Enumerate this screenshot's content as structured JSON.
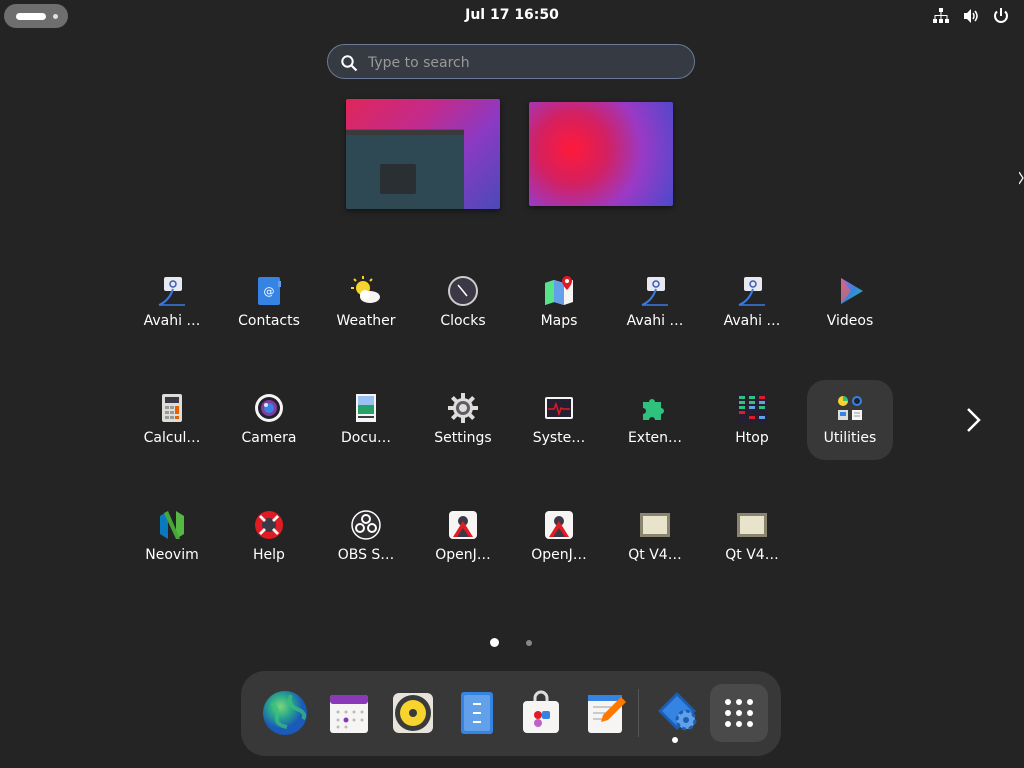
{
  "topbar": {
    "clock": "Jul 17  16:50",
    "tray_icons": [
      "network-icon",
      "volume-icon",
      "power-icon"
    ]
  },
  "search": {
    "placeholder": "Type to search",
    "value": ""
  },
  "app_grid": {
    "rows": [
      [
        {
          "label": "Avahi …",
          "icon": "avahi-icon"
        },
        {
          "label": "Contacts",
          "icon": "contacts-icon"
        },
        {
          "label": "Weather",
          "icon": "weather-icon"
        },
        {
          "label": "Clocks",
          "icon": "clocks-icon"
        },
        {
          "label": "Maps",
          "icon": "maps-icon"
        },
        {
          "label": "Avahi …",
          "icon": "avahi-icon"
        },
        {
          "label": "Avahi …",
          "icon": "avahi-icon"
        },
        {
          "label": "Videos",
          "icon": "videos-icon"
        }
      ],
      [
        {
          "label": "Calcul…",
          "icon": "calculator-icon"
        },
        {
          "label": "Camera",
          "icon": "camera-icon"
        },
        {
          "label": "Docu…",
          "icon": "document-viewer-icon"
        },
        {
          "label": "Settings",
          "icon": "settings-icon"
        },
        {
          "label": "Syste…",
          "icon": "system-monitor-icon"
        },
        {
          "label": "Exten…",
          "icon": "extensions-icon"
        },
        {
          "label": "Htop",
          "icon": "htop-icon"
        },
        {
          "label": "Utilities",
          "icon": "folder-icon"
        }
      ],
      [
        {
          "label": "Neovim",
          "icon": "neovim-icon"
        },
        {
          "label": "Help",
          "icon": "help-icon"
        },
        {
          "label": "OBS S…",
          "icon": "obs-icon"
        },
        {
          "label": "OpenJ…",
          "icon": "openjdk-icon"
        },
        {
          "label": "OpenJ…",
          "icon": "openjdk-icon"
        },
        {
          "label": "Qt V4…",
          "icon": "qt-v4l2-icon"
        },
        {
          "label": "Qt V4…",
          "icon": "qt-v4l2-icon"
        }
      ]
    ]
  },
  "pager": {
    "pages": 2,
    "current": 1
  },
  "dock": {
    "items": [
      "web-browser-icon",
      "calendar-icon",
      "rhythmbox-icon",
      "files-icon",
      "software-icon",
      "text-editor-icon",
      "software-properties-icon",
      "show-apps-icon"
    ],
    "running": [
      "software-properties-icon"
    ]
  },
  "colors": {
    "background": "#242424",
    "accent": "#3584e4",
    "search_border": "#6b7a96"
  }
}
